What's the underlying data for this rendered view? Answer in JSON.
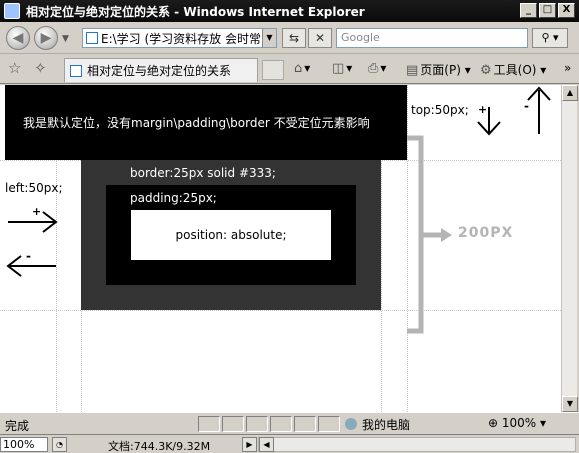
{
  "window": {
    "title": "相对定位与绝对定位的关系 - Windows Internet Explorer",
    "minimize": "_",
    "maximize": "□",
    "close": "X"
  },
  "address_bar": {
    "url": "E:\\学习 (学习资料存放 会时常",
    "search_placeholder": "Google"
  },
  "tab": {
    "label": "相对定位与绝对定位的关系"
  },
  "commands": {
    "page": "页面(P)",
    "tools": "工具(O)"
  },
  "content": {
    "banner_text": "我是默认定位，没有margin\\padding\\border 不受定位元素影响",
    "top_label": "top:50px;",
    "left_label": "left:50px;",
    "border_label": "border:25px solid #333;",
    "padding_label": "padding:25px;",
    "abs_label": "position: absolute;",
    "height_label": "200PX",
    "plus": "+",
    "minus": "-"
  },
  "status": {
    "text": "完成",
    "zone": "我的电脑",
    "zoom": "100%"
  },
  "bottom": {
    "zoom": "100%",
    "doc": "文档:744.3K/9.32M"
  },
  "colors": {
    "banner": "#000000",
    "outer_border": "#333333",
    "guide": "#b4b4b4"
  }
}
